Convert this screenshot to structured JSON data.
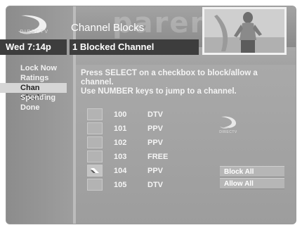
{
  "brand": {
    "logo_text": "DIRECTV",
    "watermark": "parental"
  },
  "header": {
    "title": "Channel Blocks",
    "time": "Wed 7:14p",
    "status": "1 Blocked Channel"
  },
  "menu": {
    "items": [
      {
        "label": "Lock Now",
        "active": false
      },
      {
        "label": "Ratings",
        "active": false
      },
      {
        "label": "Chan Blocks",
        "active": true
      },
      {
        "label": "Spending",
        "active": false
      },
      {
        "label": "Done",
        "active": false
      }
    ]
  },
  "instructions": {
    "line1": "Press SELECT on a checkbox to block/allow a channel.",
    "line2": "Use NUMBER keys to jump to a channel."
  },
  "channels": [
    {
      "number": "100",
      "type": "DTV",
      "blocked": false
    },
    {
      "number": "101",
      "type": "PPV",
      "blocked": false
    },
    {
      "number": "102",
      "type": "PPV",
      "blocked": false
    },
    {
      "number": "103",
      "type": "FREE",
      "blocked": false
    },
    {
      "number": "104",
      "type": "PPV",
      "blocked": true
    },
    {
      "number": "105",
      "type": "DTV",
      "blocked": false
    }
  ],
  "actions": {
    "block_all": "Block All",
    "allow_all": "Allow All"
  }
}
